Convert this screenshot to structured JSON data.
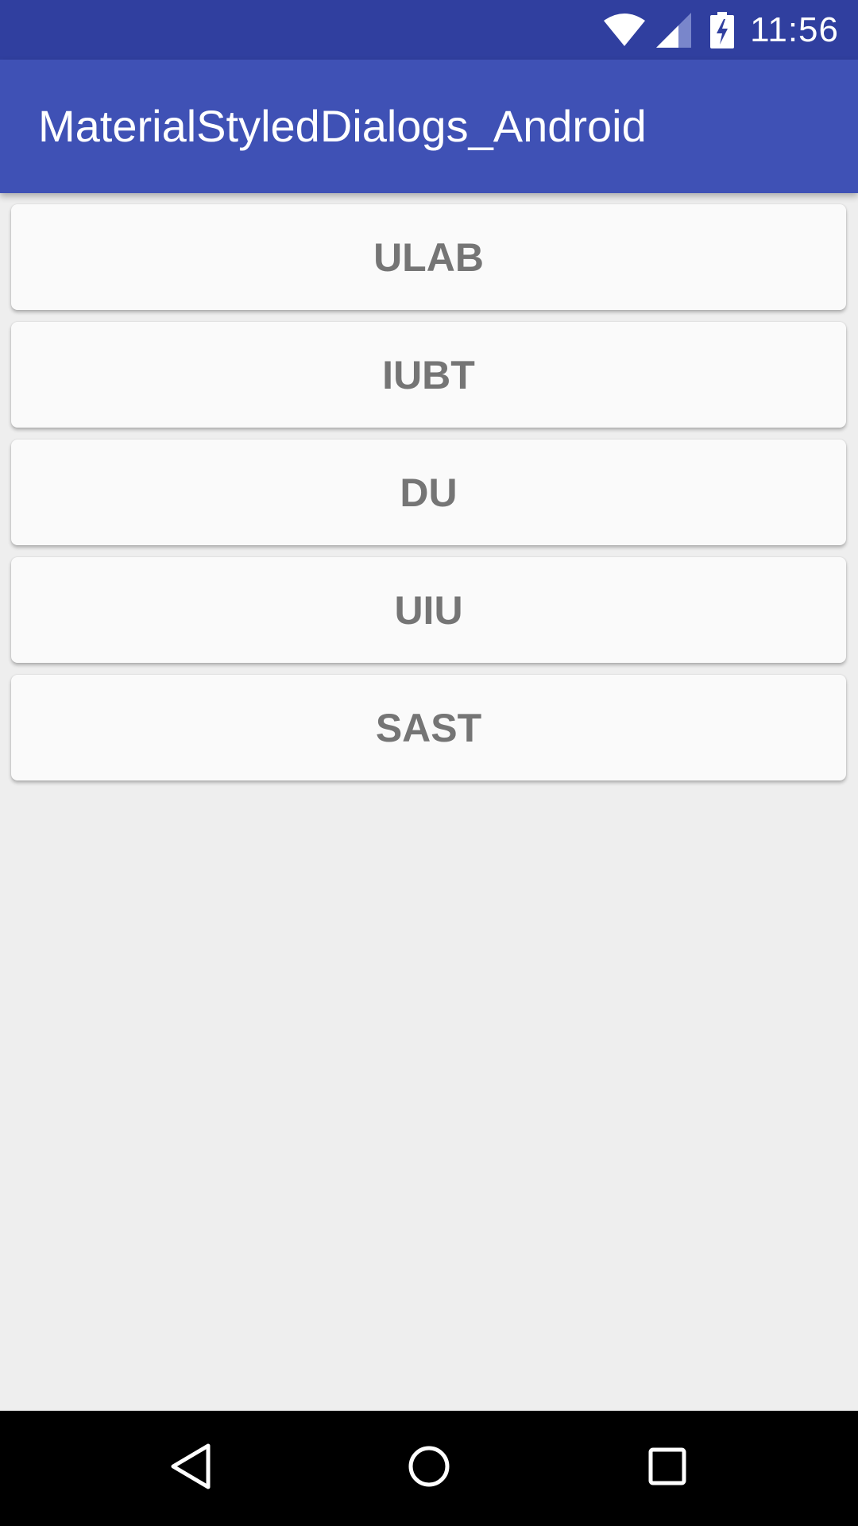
{
  "status_bar": {
    "time": "11:56",
    "icons": [
      "wifi-icon",
      "cell-signal-icon",
      "battery-charging-icon"
    ],
    "color": "#303f9f"
  },
  "app_bar": {
    "title": "MaterialStyledDialogs_Android",
    "color": "#3f51b5"
  },
  "buttons": [
    {
      "label": "ULAB"
    },
    {
      "label": "IUBT"
    },
    {
      "label": "DU"
    },
    {
      "label": "UIU"
    },
    {
      "label": "SAST"
    }
  ],
  "nav_bar": {
    "icons": [
      "back-icon",
      "home-icon",
      "recents-icon"
    ]
  },
  "colors": {
    "background": "#eeeeee",
    "button_bg": "#fafafa",
    "button_text": "#757575"
  }
}
